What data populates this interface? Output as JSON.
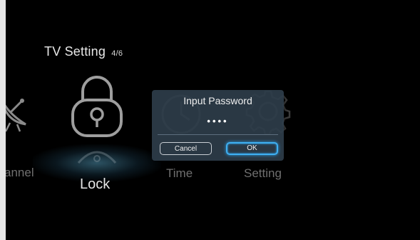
{
  "header": {
    "title": "TV Setting",
    "page_indicator": "4/6"
  },
  "menu_items": [
    {
      "label": "annel",
      "icon": "satellite-dish-icon",
      "state": "inactive"
    },
    {
      "label": "Lock",
      "icon": "lock-icon",
      "state": "focused"
    },
    {
      "label": "Time",
      "icon": "clock-icon",
      "state": "inactive"
    },
    {
      "label": "Setting",
      "icon": "gear-icon",
      "state": "inactive"
    }
  ],
  "dialog": {
    "title": "Input Password",
    "password_mask": "••••",
    "cancel_label": "Cancel",
    "ok_label": "OK"
  },
  "colors": {
    "background": "#000000",
    "dialog_bg": "#2e3d4a",
    "focus_accent": "#3fb0f2",
    "inactive_text": "#6f6f6f",
    "active_text": "#e6e6e6"
  }
}
